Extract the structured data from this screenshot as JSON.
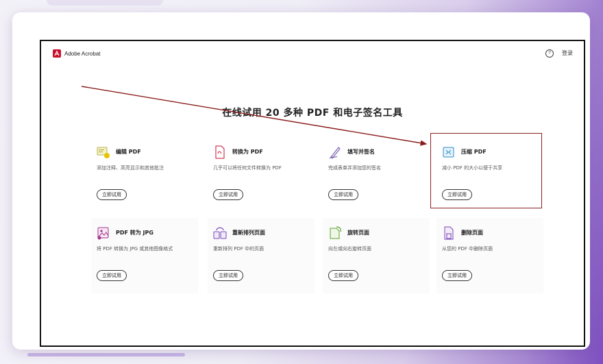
{
  "app": {
    "logo_text": "Adobe Acrobat",
    "help_symbol": "?",
    "login_label": "登录"
  },
  "headline": "在线试用 20 多种 PDF 和电子签名工具",
  "tools": [
    {
      "title": "编辑 PDF",
      "desc": "添加注释、高亮显示和其他批注",
      "button": "立即试用",
      "icon": "edit-pdf-icon"
    },
    {
      "title": "转换为 PDF",
      "desc": "几乎可以将任何文件转换为 PDF",
      "button": "立即试用",
      "icon": "convert-pdf-icon"
    },
    {
      "title": "填写并签名",
      "desc": "完成表单并添加您的签名",
      "button": "立即试用",
      "icon": "fill-sign-icon"
    },
    {
      "title": "压缩 PDF",
      "desc": "减小 PDF 的大小以便于共享",
      "button": "立即试用",
      "icon": "compress-pdf-icon"
    },
    {
      "title": "PDF 转为 JPG",
      "desc": "将 PDF 转换为 JPG 或其他图像格式",
      "button": "立即试用",
      "icon": "pdf-to-jpg-icon"
    },
    {
      "title": "重新排列页面",
      "desc": "重新排列 PDF 中的页面",
      "button": "立即试用",
      "icon": "reorder-pages-icon"
    },
    {
      "title": "旋转页面",
      "desc": "向左或向右旋转页面",
      "button": "立即试用",
      "icon": "rotate-pages-icon"
    },
    {
      "title": "删除页面",
      "desc": "从您的 PDF 中删除页面",
      "button": "立即试用",
      "icon": "delete-pages-icon"
    }
  ],
  "colors": {
    "brand_red": "#c8102e",
    "annotation_red": "#8b1c1c",
    "purple_bg": "#7e4fc0"
  }
}
